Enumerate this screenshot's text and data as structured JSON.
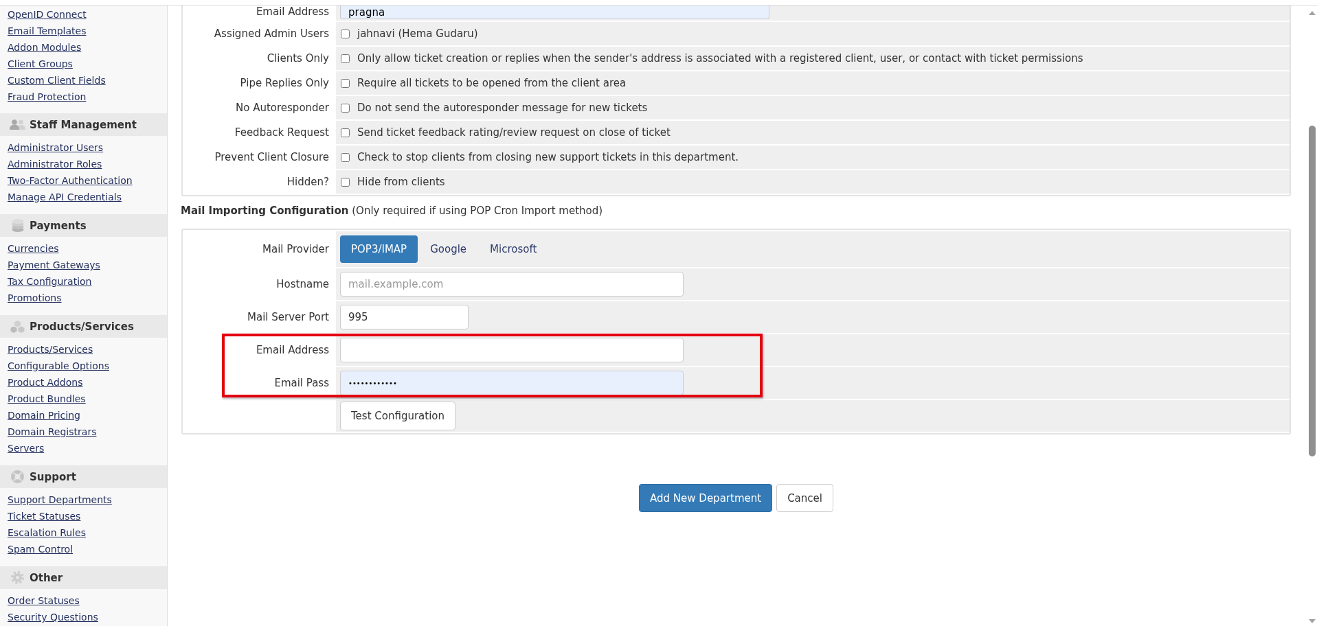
{
  "sidebar": {
    "items": [
      "OpenID Connect",
      "Email Templates",
      "Addon Modules",
      "Client Groups",
      "Custom Client Fields",
      "Fraud Protection"
    ],
    "sections": [
      {
        "title": "Staff Management",
        "items": [
          "Administrator Users",
          "Administrator Roles",
          "Two-Factor Authentication",
          "Manage API Credentials"
        ]
      },
      {
        "title": "Payments",
        "items": [
          "Currencies",
          "Payment Gateways",
          "Tax Configuration",
          "Promotions"
        ]
      },
      {
        "title": "Products/Services",
        "items": [
          "Products/Services",
          "Configurable Options",
          "Product Addons",
          "Product Bundles",
          "Domain Pricing",
          "Domain Registrars",
          "Servers"
        ]
      },
      {
        "title": "Support",
        "items": [
          "Support Departments",
          "Ticket Statuses",
          "Escalation Rules",
          "Spam Control"
        ]
      },
      {
        "title": "Other",
        "items": [
          "Order Statuses",
          "Security Questions"
        ]
      }
    ]
  },
  "department_form": {
    "rows": [
      {
        "kind": "text",
        "label": "Email Address",
        "value": "pragna",
        "autofilled": true
      },
      {
        "kind": "checkbox",
        "label": "Assigned Admin Users",
        "text": "jahnavi (Hema Gudaru)",
        "checked": false
      },
      {
        "kind": "checkbox",
        "label": "Clients Only",
        "text": "Only allow ticket creation or replies when the sender's address is associated with a registered client, user, or contact with ticket permissions",
        "checked": false
      },
      {
        "kind": "checkbox",
        "label": "Pipe Replies Only",
        "text": "Require all tickets to be opened from the client area",
        "checked": false
      },
      {
        "kind": "checkbox",
        "label": "No Autoresponder",
        "text": "Do not send the autoresponder message for new tickets",
        "checked": false
      },
      {
        "kind": "checkbox",
        "label": "Feedback Request",
        "text": "Send ticket feedback rating/review request on close of ticket",
        "checked": false
      },
      {
        "kind": "checkbox",
        "label": "Prevent Client Closure",
        "text": "Check to stop clients from closing new support tickets in this department.",
        "checked": false
      },
      {
        "kind": "checkbox",
        "label": "Hidden?",
        "text": "Hide from clients",
        "checked": false
      }
    ]
  },
  "mail_importing": {
    "heading": "**Mail Importing Configuration** (Only required if using POP Cron Import method)",
    "rows": [
      {
        "kind": "tabs",
        "label": "Mail Provider",
        "options": [
          {
            "label": "POP3/IMAP",
            "selected": true
          },
          {
            "label": "Google",
            "selected": false
          },
          {
            "label": "Microsoft",
            "selected": false
          }
        ],
        "highlighted": false
      },
      {
        "kind": "text",
        "label": "Hostname",
        "placeholder": "mail.example.com",
        "autofilled": false,
        "highlighted": false
      },
      {
        "kind": "number",
        "label": "Mail Server Port",
        "value": "995",
        "autofilled": false,
        "highlighted": false
      },
      {
        "kind": "text",
        "label": "Email Address",
        "autofilled": false,
        "highlighted": true
      },
      {
        "kind": "password",
        "label": "Email Pass",
        "value": "••••••••••••",
        "autofilled": true,
        "highlighted": true
      },
      {
        "kind": "button",
        "text": "Test Configuration",
        "highlighted": false
      }
    ]
  },
  "actions": [
    {
      "kind": "primary",
      "label": "Add New Department"
    },
    {
      "kind": "default",
      "label": "Cancel"
    }
  ]
}
